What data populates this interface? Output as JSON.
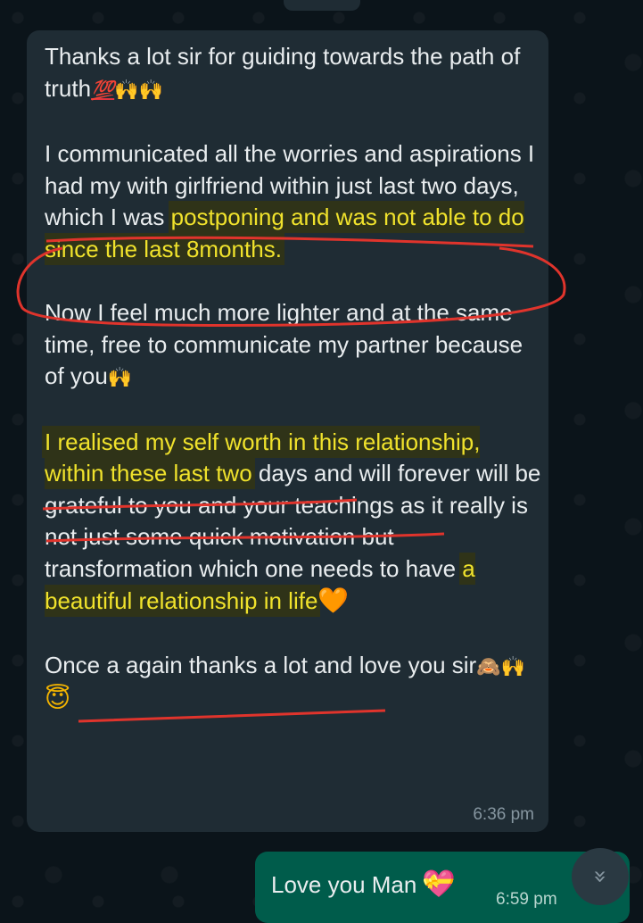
{
  "chat": {
    "incoming": {
      "p1": "Thanks a lot sir for guiding towards the path of truth",
      "p1_emoji_hundred": "💯",
      "p1_emoji_hands": "🙌🙌",
      "p2_plain": "I communicated all the worries and aspirations I had my with girlfriend within just last two days, which I was",
      "p2_highlight": "postponing and was not able to do since the last 8months.",
      "p3": "Now I feel much more lighter and at the same time, free to communicate my partner because of you",
      "p3_emoji": "🙌",
      "p4_highlight": "I realised my self worth in this relationship, within these last two",
      "p4_plain": "days and will forever will be grateful to you and your teachings as it really is not just some quick motivation but transformation which one needs to have",
      "p4_highlight_end": "a beautiful relationship in life",
      "p4_emoji": "🧡",
      "p5": "Once a again thanks a lot and love you sir",
      "p5_emoji_monkey": "🙈",
      "p5_emoji_hands": "🙌",
      "p5_emoji_face": "😇",
      "time": "6:36 pm"
    },
    "outgoing": {
      "text": "Love you Man",
      "emoji": "💝",
      "time": "6:59 pm"
    },
    "scroll_icon": "double-chevron-down-icon"
  },
  "colors": {
    "background": "#0b141a",
    "incoming_bubble": "#1f2c34",
    "outgoing_bubble": "#005c4b",
    "highlight_text": "#f0e22c",
    "annotation_red": "#e0342c"
  }
}
